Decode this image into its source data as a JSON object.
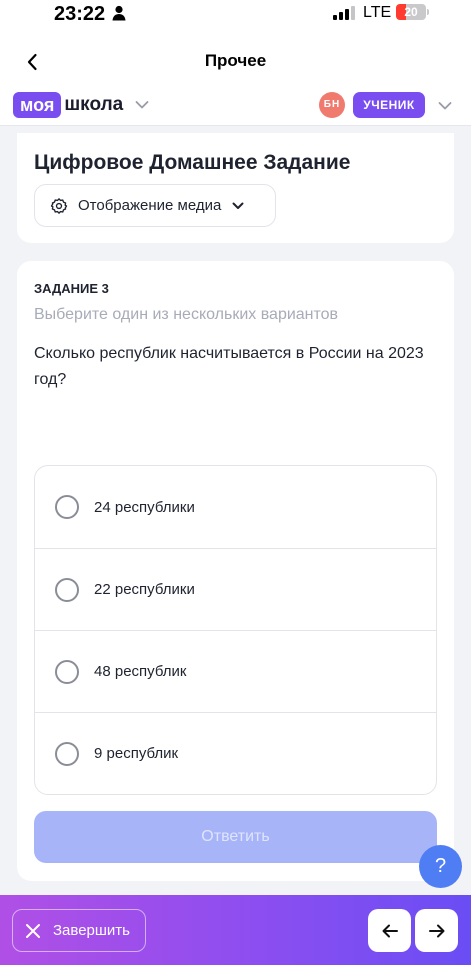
{
  "status": {
    "time": "23:22",
    "network": "LTE",
    "battery_level": "20",
    "battery_fraction": 0.2
  },
  "nav": {
    "title": "Прочее"
  },
  "brand": {
    "badge": "моя",
    "text": "школа",
    "avatar_initials": "БН",
    "role_label": "УЧЕНИК"
  },
  "header": {
    "title": "Цифровое Домашнее Задание",
    "media_button_label": "Отображение медиа"
  },
  "task": {
    "label": "ЗАДАНИЕ 3",
    "hint": "Выберите один из нескольких вариантов",
    "question": "Сколько республик насчитывается в России на 2023 год?",
    "options": [
      {
        "label": "24 республики"
      },
      {
        "label": "22 республики"
      },
      {
        "label": "48 республик"
      },
      {
        "label": "9 республик"
      }
    ],
    "submit_label": "Ответить"
  },
  "help": {
    "label": "?"
  },
  "bottom_bar": {
    "finish_label": "Завершить"
  },
  "colors": {
    "brand_purple": "#7a4df0",
    "help_blue": "#4f7df3",
    "submit_disabled": "#a7b4f8",
    "avatar": "#f07a6e"
  },
  "icons": {
    "back": "chevron-left-icon",
    "brand_chevron": "chevron-down-icon",
    "media": "gear-icon",
    "finish": "close-icon",
    "prev": "arrow-left-icon",
    "next": "arrow-right-icon"
  }
}
